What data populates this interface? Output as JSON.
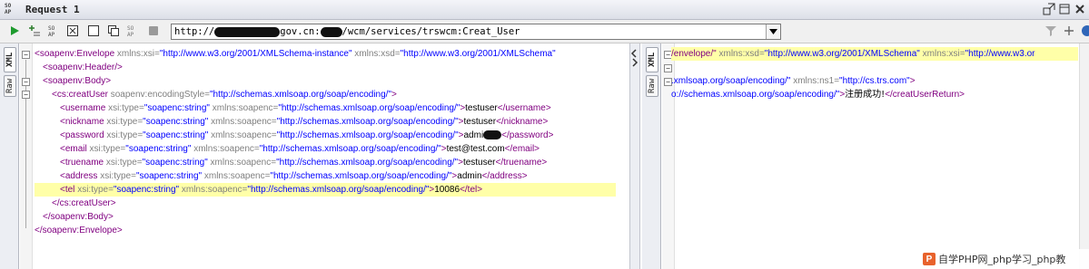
{
  "window": {
    "icon_text": "SO\nAP",
    "title": "Request 1"
  },
  "toolbar": {
    "url_prefix": "http://",
    "url_mid": "gov.cn:",
    "url_suffix": "/wcm/services/trswcm:Creat_User"
  },
  "request_tabs": [
    "XML",
    "Raw"
  ],
  "response_tabs": [
    "XML",
    "Raw"
  ],
  "request": {
    "l1_tag": "<soapenv:Envelope",
    "l1_a1": "xmlns:xsi=",
    "l1_v1": "\"http://www.w3.org/2001/XMLSchema-instance\"",
    "l1_a2": "xmlns:xsd=",
    "l1_v2": "\"http://www.w3.org/2001/XMLSchema\"",
    "l2": "<soapenv:Header/>",
    "l3": "<soapenv:Body>",
    "l4_tag": "<cs:creatUser",
    "l4_a": "soapenv:encodingStyle=",
    "l4_v": "\"http://schemas.xmlsoap.org/soap/encoding/\"",
    "l4_end": ">",
    "xsi_attr": "xsi:type=",
    "xsi_val": "\"soapenc:string\"",
    "ns_attr": "xmlns:soapenc=",
    "ns_val": "\"http://schemas.xmlsoap.org/soap/encoding/\"",
    "fields": [
      {
        "open": "<username",
        "value": "testuser",
        "close": "</username>"
      },
      {
        "open": "<nickname",
        "value": "testuser",
        "close": "</nickname>"
      },
      {
        "open": "<password",
        "value": "admi",
        "close": "</password>"
      },
      {
        "open": "<email",
        "value": "test@test.com",
        "close": "</email>"
      },
      {
        "open": "<truename",
        "value": "testuser",
        "close": "</truename>"
      },
      {
        "open": "<address",
        "value": "admin",
        "close": "</address>"
      },
      {
        "open": "<tel",
        "value": "10086",
        "close": "</tel>"
      }
    ],
    "l12": "</cs:creatUser>",
    "l13": "</soapenv:Body>",
    "l14": "</soapenv:Envelope>"
  },
  "response": {
    "r1_tag": "/envelope/\"",
    "r1_a1": "xmlns:xsd=",
    "r1_v1": "\"http://www.w3.org/2001/XMLSchema\"",
    "r1_a2": "xmlns:xsi=",
    "r1_v2": "\"http://www.w3.or",
    "r3_v": ".xmlsoap.org/soap/encoding/\"",
    "r3_a": "xmlns:ns1=",
    "r3_v2": "\"http://cs.trs.com\"",
    "r3_end": ">",
    "r4_v": "o://schemas.xmlsoap.org/soap/encoding/\"",
    "r4_gt": ">",
    "r4_text": "注册成功!",
    "r4_close": "</creatUserReturn>"
  },
  "watermark": {
    "logo": "P",
    "text": "自学PHP网_php学习_php教"
  },
  "colors": {
    "tag": "#800080",
    "attribute": "#808080",
    "value": "#0000ff",
    "highlight": "#ffffa8"
  }
}
